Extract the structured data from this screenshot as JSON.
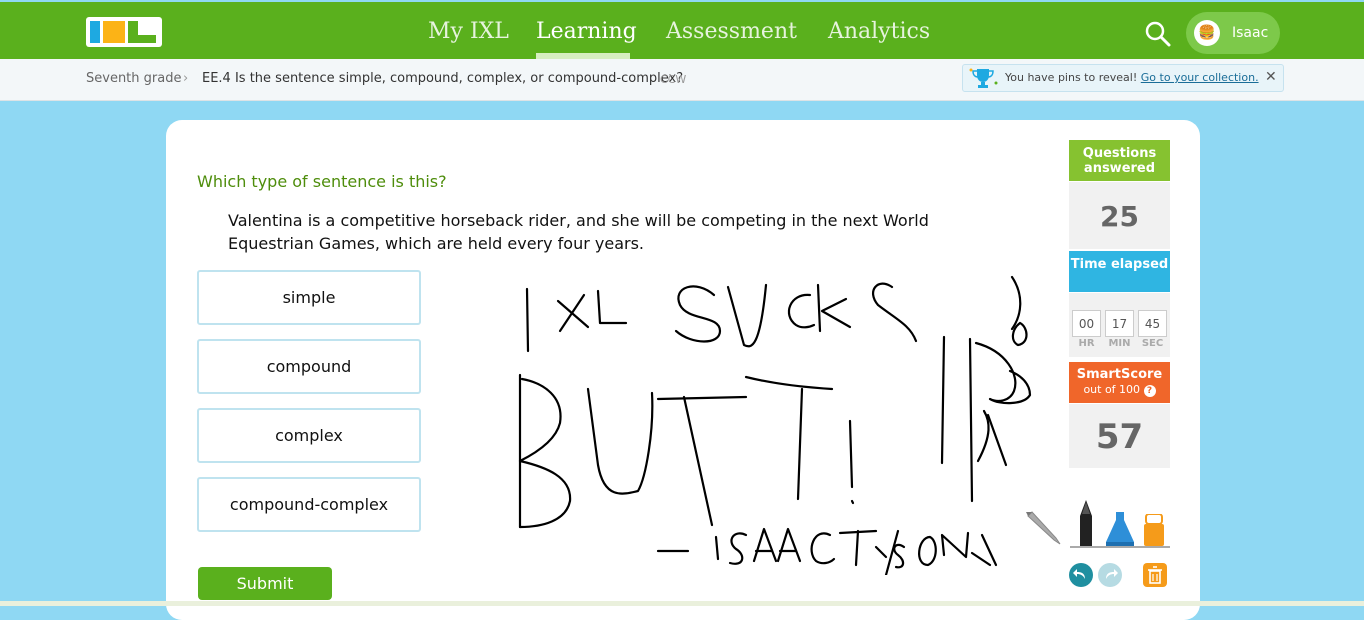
{
  "header": {
    "logo_text": "IXL",
    "nav": [
      "My IXL",
      "Learning",
      "Assessment",
      "Analytics"
    ],
    "active_nav": "Learning",
    "user_name": "Isaac",
    "accent": "#5ab01d"
  },
  "breadcrumb": {
    "grade": "Seventh grade",
    "skill": "EE.4 Is the sentence simple, compound, complex, or compound-complex?",
    "tag": "CCW"
  },
  "pins": {
    "message": "You have pins to reveal!",
    "link": "Go to your collection."
  },
  "question": {
    "prompt": "Which type of sentence is this?",
    "sentence": "Valentina is a competitive horseback rider, and she will be competing in the next World Equestrian Games, which are held every four years.",
    "choices": [
      "simple",
      "compound",
      "complex",
      "compound-complex"
    ],
    "submit_label": "Submit"
  },
  "sidebar": {
    "questions_answered_label": "Questions answered",
    "questions_answered": "25",
    "time_elapsed_label": "Time elapsed",
    "time": {
      "hr": "00",
      "min": "17",
      "sec": "45"
    },
    "time_units": {
      "hr": "HR",
      "min": "MIN",
      "sec": "SEC"
    },
    "smartscore_label": "SmartScore",
    "smartscore_sub": "out of 100",
    "smartscore": "57"
  },
  "drawing": {
    "handwritten_text": "IXL SUCKS BUTT! -ISAACTYSON"
  },
  "tools": [
    "pencil-icon",
    "pen-icon",
    "marker-icon",
    "highlighter-icon",
    "undo-icon",
    "redo-icon",
    "trash-icon"
  ]
}
